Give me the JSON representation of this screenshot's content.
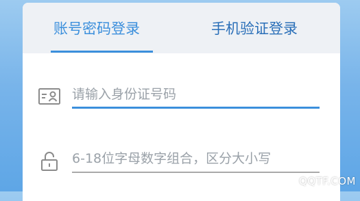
{
  "tabs": {
    "password_login": "账号密码登录",
    "sms_login": "手机验证登录"
  },
  "fields": {
    "account_placeholder": "请输入身份证号码",
    "account_value": "",
    "password_placeholder": "6-18位字母数字组合，区分大小写",
    "password_value": ""
  },
  "icons": {
    "account": "id-card-icon",
    "password": "lock-icon"
  },
  "colors": {
    "accent": "#3b8fdc",
    "tab_inactive": "#2a6fb8",
    "tab_bar_bg": "#eef1f5",
    "placeholder": "#9aa1a8"
  },
  "watermark": "QQTF.COM"
}
